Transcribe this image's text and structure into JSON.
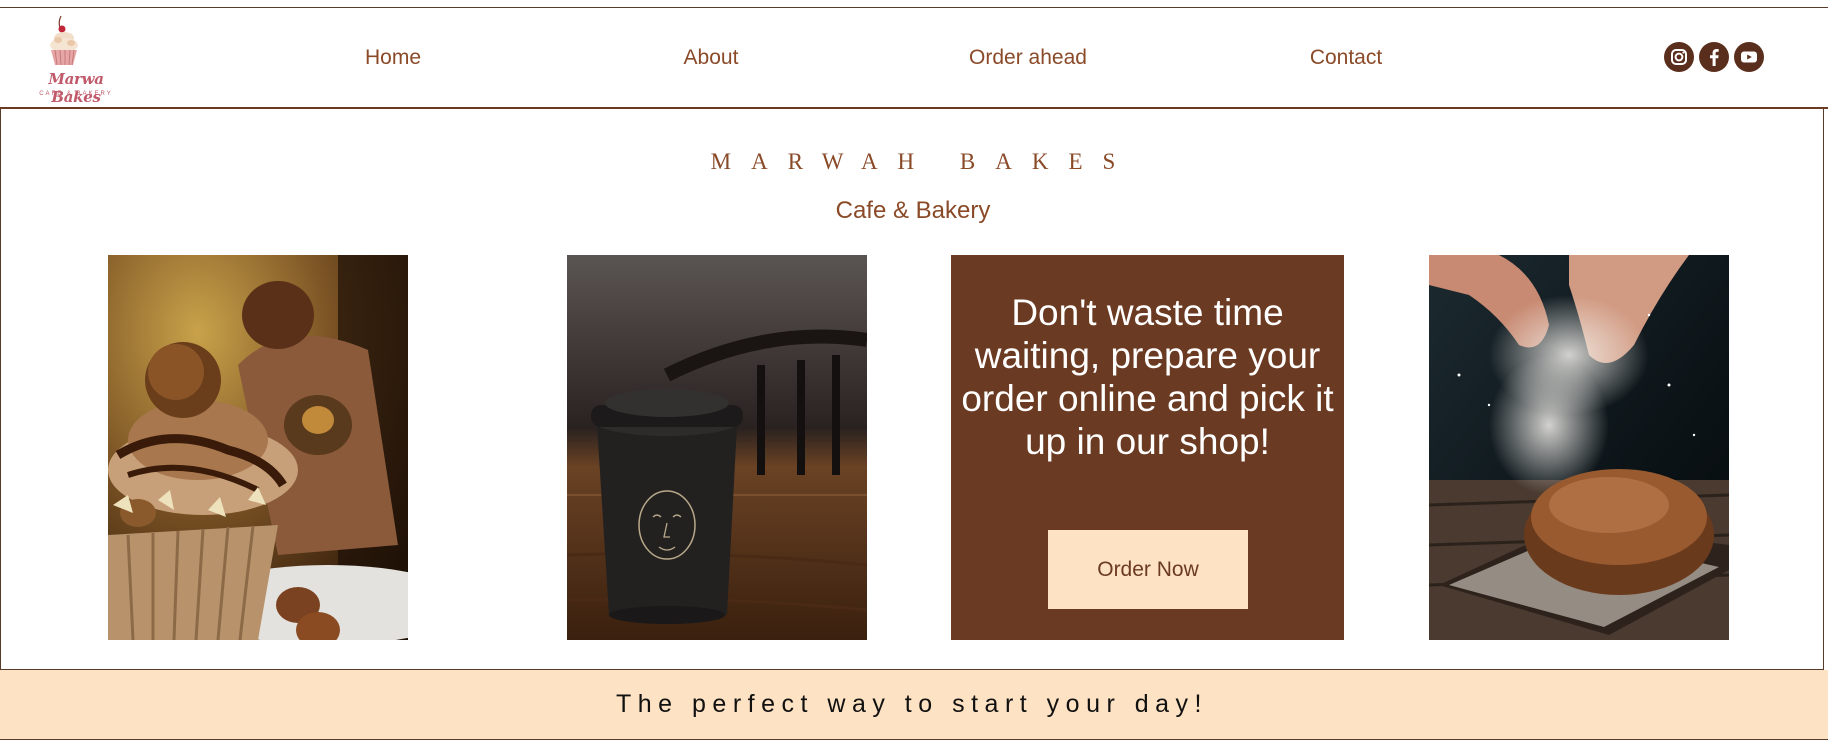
{
  "colors": {
    "brown": "#6b3a22",
    "link_brown": "#8a4a28",
    "cream": "#fde2c4",
    "social_icon_bg": "#5a2e1c"
  },
  "header": {
    "logo": {
      "name": "Marwa Bakes",
      "tagline": "CAFE & BAKERY"
    },
    "nav": [
      {
        "label": "Home"
      },
      {
        "label": "About"
      },
      {
        "label": "Order ahead"
      },
      {
        "label": "Contact"
      }
    ],
    "social": [
      {
        "icon": "instagram-icon"
      },
      {
        "icon": "facebook-icon"
      },
      {
        "icon": "youtube-icon"
      }
    ]
  },
  "hero": {
    "title": "MARWAH BAKES",
    "subtitle": "Cafe & Bakery",
    "images": [
      {
        "name": "chocolate-cupcake-photo"
      },
      {
        "name": "coffee-cup-photo"
      },
      {
        "name": "bread-flour-photo"
      }
    ],
    "promo": {
      "text": "Don't waste time waiting, prepare your order online and pick it up in our shop!",
      "button_label": "Order Now"
    }
  },
  "banner": {
    "text": "The perfect way to start your day!"
  }
}
